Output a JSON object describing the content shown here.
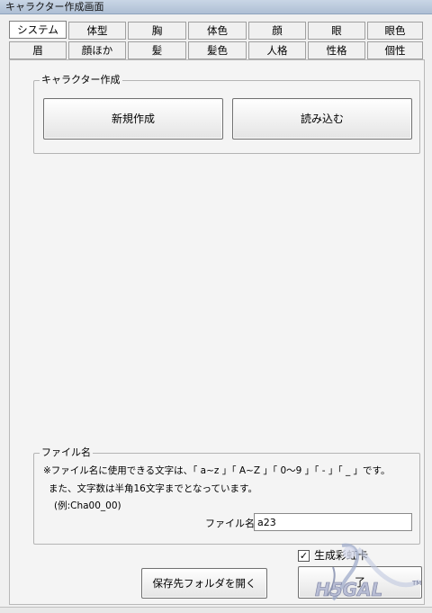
{
  "window": {
    "title": "キャラクター作成画面"
  },
  "tabs": {
    "row1": [
      "システム",
      "体型",
      "胸",
      "体色",
      "顔",
      "眼",
      "眼色"
    ],
    "row2": [
      "眉",
      "顔ほか",
      "髪",
      "髪色",
      "人格",
      "性格",
      "個性"
    ],
    "active": "システム"
  },
  "character_group": {
    "legend": "キャラクター作成",
    "new_label": "新規作成",
    "load_label": "読み込む"
  },
  "file_group": {
    "legend": "ファイル名",
    "note1": "※ファイル名に使用できる文字は、「 a~z 」「 A~Z 」「 0～9 」「 - 」「 _ 」です。",
    "note2": "また、文字数は半角16文字までとなっています。",
    "example": "(例:Cha00_00)",
    "field_label": "ファイル名:",
    "field_value": "a23"
  },
  "checkbox": {
    "label": "生成彩虹卡",
    "checked": true,
    "mark": "✓"
  },
  "footer": {
    "open_folder_label": "保存先フォルダを開く",
    "second_button_label": "了"
  },
  "watermark": {
    "text": "H5GAL",
    "tm": "TM"
  }
}
